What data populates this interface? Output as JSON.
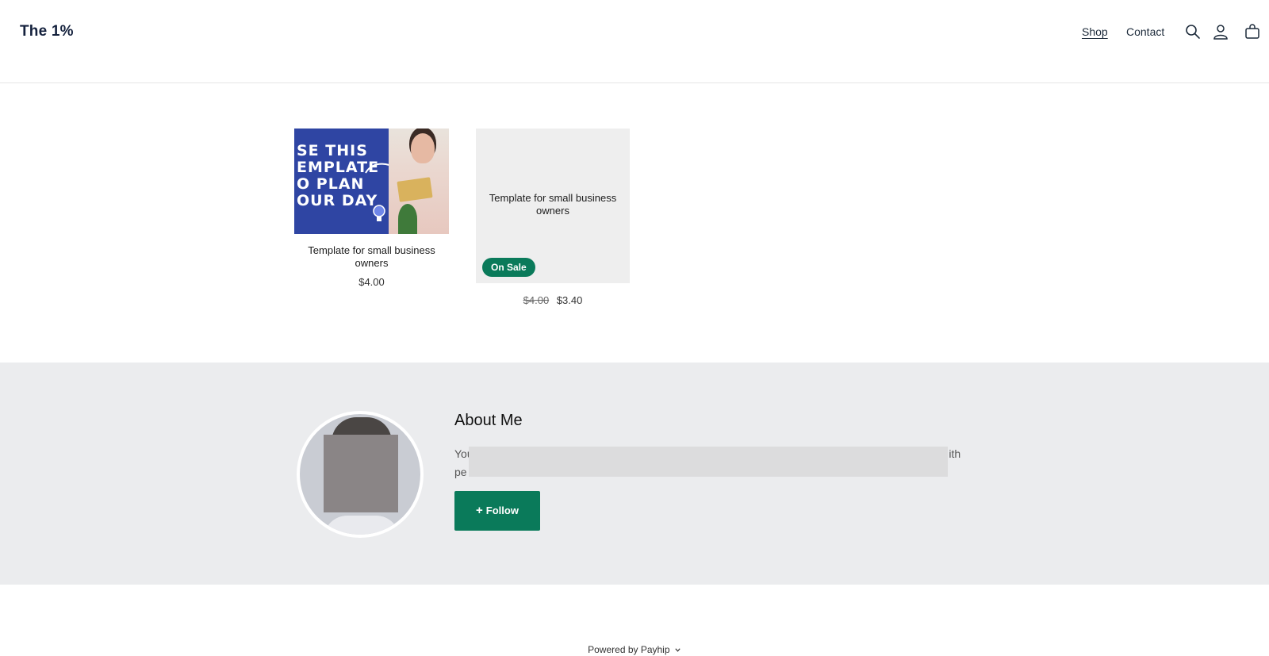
{
  "header": {
    "logo": "The 1%",
    "nav": [
      {
        "label": "Shop"
      },
      {
        "label": "Contact"
      }
    ],
    "icons": [
      "search-icon",
      "account-icon",
      "cart-icon"
    ]
  },
  "products": [
    {
      "title": "Template for small business owners",
      "price": "$4.00",
      "thumbnail_text": "SE THIS\nEMPLATE\nO PLAN\nOUR DAY"
    },
    {
      "title": "Template for small business owners",
      "thumbnail_title": "Template for small business owners",
      "badge": "On Sale",
      "old_price": "$4.00",
      "price": "$3.40"
    }
  ],
  "about": {
    "title": "About Me",
    "text_start": "You",
    "text_end": "ith",
    "text_line2_start": "pe",
    "follow_label": "Follow",
    "follow_icon": "+"
  },
  "footer": {
    "powered_by": "Powered by Payhip"
  },
  "colors": {
    "accent": "#0a7a5a",
    "about_bg": "#ebecee",
    "thumb_blue": "#2f45a3"
  }
}
